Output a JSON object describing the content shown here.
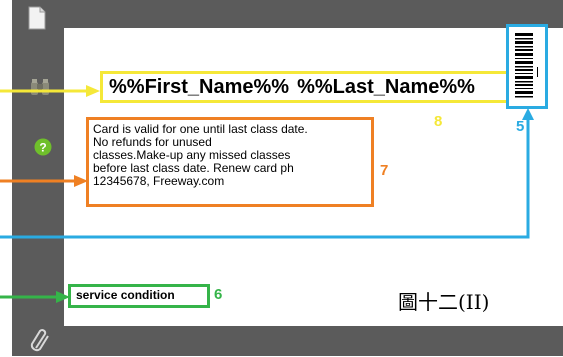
{
  "card": {
    "name_first": "%%First_Name%%",
    "name_last": "%%Last_Name%%",
    "terms_lines": [
      "Card is valid for one until last class date.",
      "No refunds for unused",
      "classes.Make-up any missed classes",
      "before last class date. Renew card ph",
      "12345678, Freeway.com"
    ],
    "service_condition": "service condition"
  },
  "callouts": {
    "n8": "8",
    "n7": "7",
    "n5": "5",
    "n6": "6"
  },
  "caption": "圖十二(II)",
  "sidebar_icons": [
    "document-icon",
    "binoculars-icon",
    "help-icon",
    "paperclip-icon"
  ],
  "colors": {
    "yellow": "#f5e838",
    "orange": "#ef8023",
    "blue": "#2aabe2",
    "green": "#35b449",
    "chrome": "#5b5b5b"
  }
}
